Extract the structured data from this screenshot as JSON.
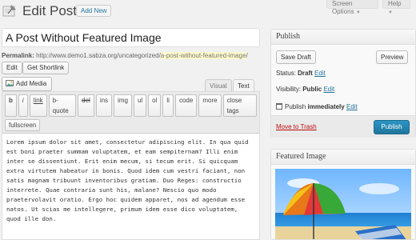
{
  "header": {
    "title": "Edit Post",
    "add_new_label": "Add New",
    "screen_options_label": "Screen Options",
    "help_label": "Help"
  },
  "post": {
    "title": "A Post Without Featured Image",
    "permalink_label": "Permalink:",
    "permalink_base": "http://www.demo1.sabza.org/uncategorized/",
    "permalink_slug": "a-post-without-featured-image",
    "permalink_suffix": "/",
    "edit_label": "Edit",
    "get_shortlink_label": "Get Shortlink"
  },
  "editor": {
    "add_media_label": "Add Media",
    "tabs": {
      "visual": "Visual",
      "text": "Text"
    },
    "active_tab": "Text",
    "toolbar_row1": [
      "b",
      "i",
      "link",
      "b-quote",
      "del",
      "ins",
      "img",
      "ul",
      "ol",
      "li",
      "code",
      "more",
      "close tags"
    ],
    "toolbar_row2": [
      "fullscreen"
    ],
    "content": "Lorem ipsum dolor sit amet, consectetur adipiscing elit. In qua quid\nest boni praeter summam voluptatem, et eam sempiternam? Illi enim\ninter se dissentiunt. Erit enim mecum, si tecum erit. Si quicquam\nextra virtutem habeatur in bonis. Quod idem cum vestri faciant, non\nsatis magnam tribuunt inventoribus gratiam. Duo Reges: constructio\ninterrete. Quae contraria sunt his, malane? Nescio quo modo\npraetervolavit oratio. Ergo hoc quidem apparet, nos ad agendum esse\nnatos. Ut scias me intellegere, primum idem esse dico voluptatem,\nquod ille don."
  },
  "publish_box": {
    "title": "Publish",
    "save_draft_label": "Save Draft",
    "preview_label": "Preview",
    "status_label": "Status:",
    "status_value": "Draft",
    "visibility_label": "Visibility:",
    "visibility_value": "Public",
    "publish_text": "Publish",
    "publish_when": "immediately",
    "edit_label": "Edit",
    "trash_label": "Move to Trash",
    "publish_button_label": "Publish"
  },
  "featured_box": {
    "title": "Featured Image"
  },
  "colors": {
    "link": "#21759b",
    "trash": "#bc0b0b",
    "publish_button": "#21759b",
    "slug_highlight": "#fffbcc"
  },
  "icons": [
    "post-pushpin-icon",
    "add-media-icon",
    "calendar-icon",
    "beach-umbrella-image"
  ]
}
